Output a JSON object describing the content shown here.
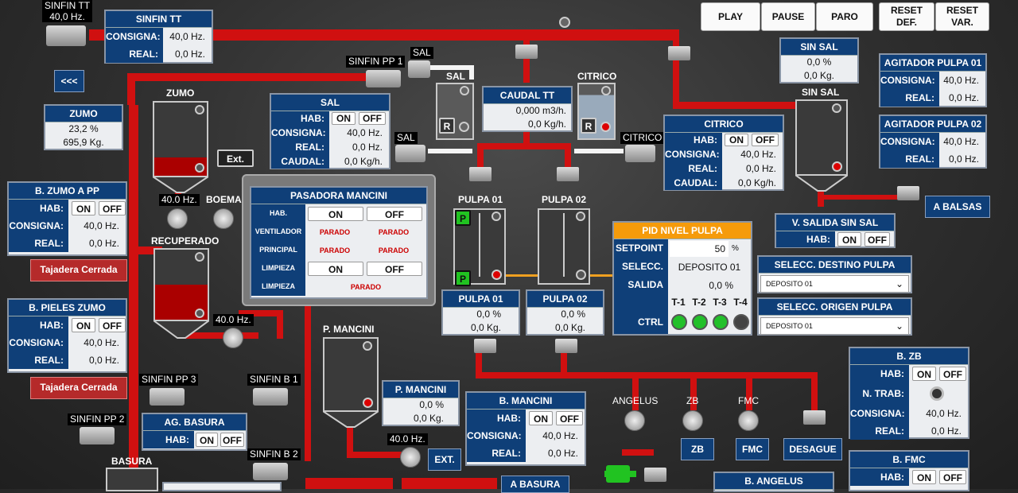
{
  "topbar": {
    "play": "PLAY",
    "pause": "PAUSE",
    "paro": "PARO",
    "reset_def": "RESET DEF.",
    "reset_var": "RESET VAR."
  },
  "back_btn": "<<<",
  "sinfin_tt": {
    "tag": "SINFIN TT",
    "freq": "40,0 Hz.",
    "title": "SINFIN TT",
    "consigna_l": "CONSIGNA:",
    "consigna": "40,0 Hz.",
    "real_l": "REAL:",
    "real": "0,0 Hz."
  },
  "labels": {
    "sinfin_pp1": "SINFIN PP 1",
    "sal_motor": "SAL",
    "sal_tank": "SAL",
    "citrico_tank": "CITRICO",
    "sal_side": "SAL",
    "citrico_side": "CITRICO",
    "zumo_tank": "ZUMO",
    "recuperado": "RECUPERADO",
    "p_mancini": "P. MANCINI",
    "sinfin_pp3": "SINFIN PP 3",
    "sinfin_b1": "SINFIN B 1",
    "sinfin_pp2": "SINFIN PP 2",
    "sinfin_b2": "SINFIN B 2",
    "basura": "BASURA",
    "pulpa01": "PULPA 01",
    "pulpa02": "PULPA 02",
    "angelus": "ANGELUS",
    "zb": "ZB",
    "fmc": "FMC",
    "sin_sal": "SIN SAL",
    "boema": "BOEMA",
    "ext": "Ext.",
    "ext2": "EXT.",
    "r1": "R",
    "r2": "R",
    "p1": "P",
    "p2": "P"
  },
  "tags": {
    "boema_hz": "40.0 Hz.",
    "rec_hz": "40.0 Hz.",
    "pm_hz": "40.0 Hz."
  },
  "zumo": {
    "title": "ZUMO",
    "pct": "23,2 %",
    "kg": "695,9 Kg."
  },
  "sal": {
    "title": "SAL",
    "hab_l": "HAB:",
    "on": "ON",
    "off": "OFF",
    "consigna_l": "CONSIGNA:",
    "consigna": "40,0 Hz.",
    "real_l": "REAL:",
    "real": "0,0 Hz.",
    "caudal_l": "CAUDAL:",
    "caudal": "0,0 Kg/h."
  },
  "caudal_tt": {
    "title": "CAUDAL TT",
    "m3": "0,000 m3/h.",
    "kg": "0,0 Kg/h."
  },
  "citrico": {
    "title": "CITRICO",
    "hab_l": "HAB:",
    "on": "ON",
    "off": "OFF",
    "consigna_l": "CONSIGNA:",
    "consigna": "40,0 Hz.",
    "real_l": "REAL:",
    "real": "0,0 Hz.",
    "caudal_l": "CAUDAL:",
    "caudal": "0,0 Kg/h."
  },
  "sin_sal": {
    "title": "SIN SAL",
    "pct": "0,0 %",
    "kg": "0,0 Kg."
  },
  "agit1": {
    "title": "AGITADOR PULPA 01",
    "consigna_l": "CONSIGNA:",
    "consigna": "40,0 Hz.",
    "real_l": "REAL:",
    "real": "0,0 Hz."
  },
  "agit2": {
    "title": "AGITADOR PULPA 02",
    "consigna_l": "CONSIGNA:",
    "consigna": "40,0 Hz.",
    "real_l": "REAL:",
    "real": "0,0 Hz."
  },
  "a_balsas": "A BALSAS",
  "v_salida": {
    "title": "V. SALIDA SIN SAL",
    "hab_l": "HAB:",
    "on": "ON",
    "off": "OFF"
  },
  "destino": {
    "title": "SELECC. DESTINO PULPA",
    "value": "DEPOSITO 01"
  },
  "origen": {
    "title": "SELECC. ORIGEN PULPA",
    "value": "DEPOSITO 01"
  },
  "bzumo": {
    "title": "B. ZUMO A PP",
    "hab_l": "HAB:",
    "on": "ON",
    "off": "OFF",
    "consigna_l": "CONSIGNA:",
    "consigna": "40,0 Hz.",
    "real_l": "REAL:",
    "real": "0,0 Hz.",
    "alarm": "Tajadera Cerrada"
  },
  "bpieles": {
    "title": "B. PIELES ZUMO",
    "hab_l": "HAB:",
    "on": "ON",
    "off": "OFF",
    "consigna_l": "CONSIGNA:",
    "consigna": "40,0 Hz.",
    "real_l": "REAL:",
    "real": "0,0 Hz.",
    "alarm": "Tajadera Cerrada"
  },
  "pasadora": {
    "title": "PASADORA MANCINI",
    "hab_l": "HAB.",
    "on": "ON",
    "off": "OFF",
    "vent_l": "VENTILADOR",
    "vent1": "PARADO",
    "vent2": "PARADO",
    "princ_l": "PRINCIPAL",
    "princ1": "PARADO",
    "princ2": "PARADO",
    "limp_l": "LIMPIEZA",
    "limp_on": "ON",
    "limp_off": "OFF",
    "limp2_l": "LIMPIEZA",
    "limp2": "PARADO"
  },
  "pid": {
    "title": "PID NIVEL PULPA",
    "sp_l": "SETPOINT",
    "sp": "50",
    "sp_unit": "%",
    "sel_l": "SELECC.",
    "sel": "DEPOSITO 01",
    "sal_l": "SALIDA",
    "sal": "0,0 %",
    "t1": "T-1",
    "t2": "T-2",
    "t3": "T-3",
    "t4": "T-4",
    "ctrl_l": "CTRL"
  },
  "pulpa01": {
    "title": "PULPA 01",
    "pct": "0,0 %",
    "kg": "0,0 Kg."
  },
  "pulpa02": {
    "title": "PULPA 02",
    "pct": "0,0 %",
    "kg": "0,0 Kg."
  },
  "pmancini": {
    "title": "P. MANCINI",
    "pct": "0,0 %",
    "kg": "0,0 Kg."
  },
  "bmancini": {
    "title": "B. MANCINI",
    "hab_l": "HAB:",
    "on": "ON",
    "off": "OFF",
    "consigna_l": "CONSIGNA:",
    "consigna": "40,0 Hz.",
    "real_l": "REAL:",
    "real": "0,0 Hz."
  },
  "agbasura": {
    "title": "AG. BASURA",
    "hab_l": "HAB:",
    "on": "ON",
    "off": "OFF"
  },
  "bzb": {
    "title": "B. ZB",
    "hab_l": "HAB:",
    "on": "ON",
    "off": "OFF",
    "ntrab_l": "N. TRAB:",
    "consigna_l": "CONSIGNA:",
    "consigna": "40,0 Hz.",
    "real_l": "REAL:",
    "real": "0,0 Hz."
  },
  "bfmc": {
    "title": "B. FMC",
    "hab_l": "HAB:",
    "on": "ON",
    "off": "OFF"
  },
  "bangelus": {
    "title": "B. ANGELUS"
  },
  "a_basura": "A BASURA",
  "dest_btns": {
    "zb": "ZB",
    "fmc": "FMC",
    "desague": "DESAGUE"
  },
  "colors": {
    "pipe": "#d01010",
    "panel_header": "#0f3f78",
    "pid_header": "#f59b0b",
    "alarm": "#b52a2a",
    "led_green": "#22c02a"
  }
}
